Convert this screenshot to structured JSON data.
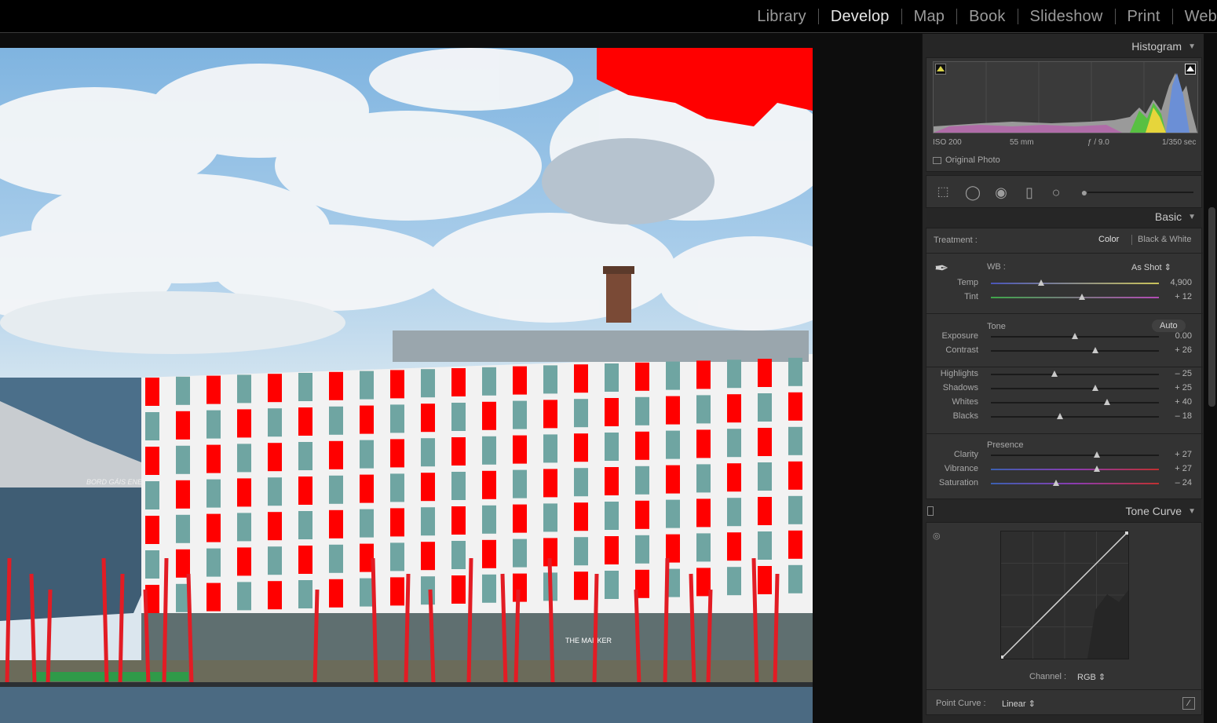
{
  "modules": [
    "Library",
    "Develop",
    "Map",
    "Book",
    "Slideshow",
    "Print",
    "Web"
  ],
  "active_module": "Develop",
  "photo": {
    "building_sign": "THE MARKER",
    "theatre_sign": "BORD GÁIS ENERGY THEATRE"
  },
  "histogram": {
    "title": "Histogram",
    "iso": "ISO 200",
    "focal": "55 mm",
    "aperture": "ƒ / 9.0",
    "shutter": "1/350 sec",
    "original_photo": "Original Photo"
  },
  "basic": {
    "title": "Basic",
    "treatment_label": "Treatment :",
    "treatment_color": "Color",
    "treatment_bw": "Black & White",
    "wb_label": "WB :",
    "wb_value": "As Shot",
    "tone_label": "Tone",
    "auto_label": "Auto",
    "presence_label": "Presence",
    "sliders": [
      {
        "key": "temp",
        "label": "Temp",
        "value": "4,900",
        "pos": 0.3
      },
      {
        "key": "tint",
        "label": "Tint",
        "value": "+ 12",
        "pos": 0.54
      },
      {
        "key": "exposure",
        "label": "Exposure",
        "value": "0.00",
        "pos": 0.5
      },
      {
        "key": "contrast",
        "label": "Contrast",
        "value": "+ 26",
        "pos": 0.62
      },
      {
        "key": "highlights",
        "label": "Highlights",
        "value": "– 25",
        "pos": 0.38
      },
      {
        "key": "shadows",
        "label": "Shadows",
        "value": "+ 25",
        "pos": 0.62
      },
      {
        "key": "whites",
        "label": "Whites",
        "value": "+ 40",
        "pos": 0.69
      },
      {
        "key": "blacks",
        "label": "Blacks",
        "value": "– 18",
        "pos": 0.41
      },
      {
        "key": "clarity",
        "label": "Clarity",
        "value": "+ 27",
        "pos": 0.63
      },
      {
        "key": "vibrance",
        "label": "Vibrance",
        "value": "+ 27",
        "pos": 0.63
      },
      {
        "key": "saturation",
        "label": "Saturation",
        "value": "– 24",
        "pos": 0.39
      }
    ]
  },
  "tone_curve": {
    "title": "Tone Curve",
    "channel_label": "Channel :",
    "channel_value": "RGB",
    "point_curve_label": "Point Curve :",
    "point_curve_value": "Linear"
  },
  "icons": [
    "shadow-clipping-icon",
    "highlight-clipping-icon",
    "crop-icon",
    "spot-removal-icon",
    "red-eye-icon",
    "graduated-filter-icon",
    "radial-filter-icon",
    "adjustment-brush-icon",
    "eyedropper-icon",
    "targeted-adjust-icon",
    "curve-edit-icon"
  ]
}
